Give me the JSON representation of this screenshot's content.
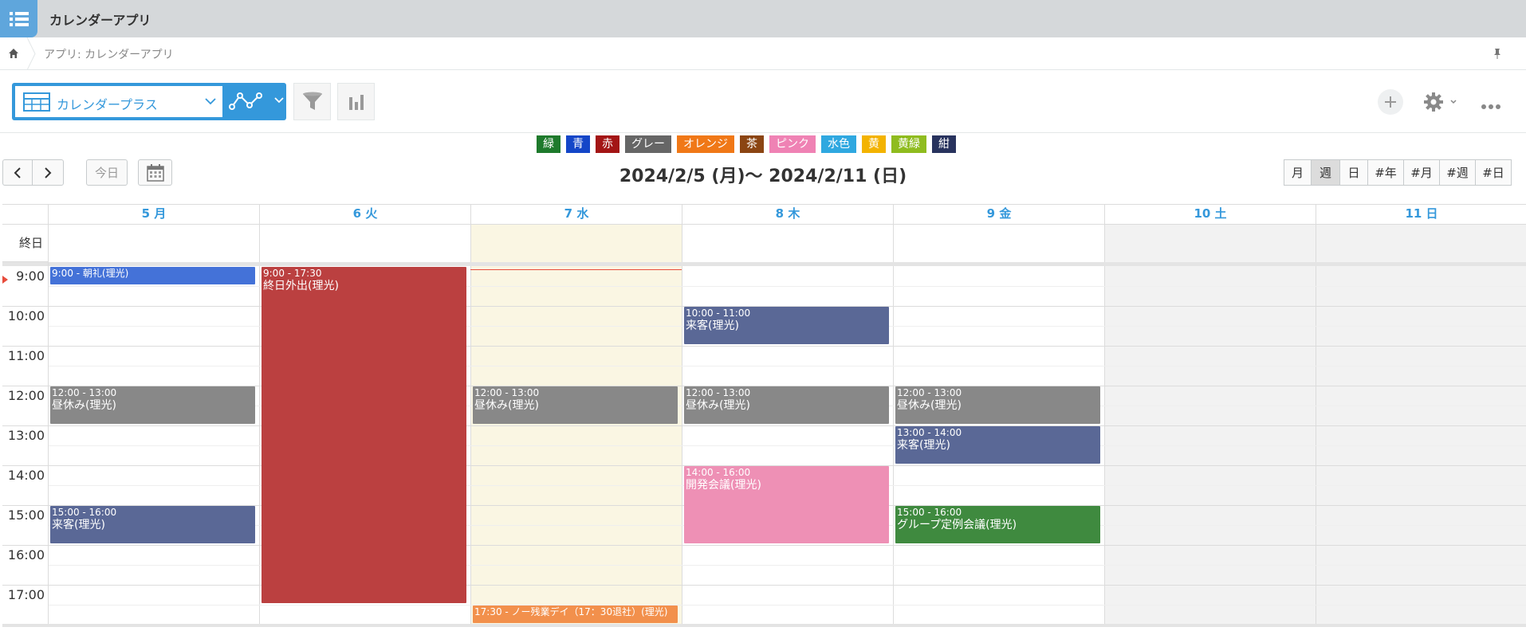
{
  "app": {
    "title": "カレンダーアプリ"
  },
  "breadcrumb": {
    "text": "アプリ: カレンダーアプリ"
  },
  "toolbar": {
    "view_label": "カレンダープラス"
  },
  "legend": [
    {
      "label": "緑",
      "color": "#1e7a2c"
    },
    {
      "label": "青",
      "color": "#1446c8"
    },
    {
      "label": "赤",
      "color": "#a31515"
    },
    {
      "label": "グレー",
      "color": "#666666"
    },
    {
      "label": "オレンジ",
      "color": "#f07817"
    },
    {
      "label": "茶",
      "color": "#8b4513"
    },
    {
      "label": "ピンク",
      "color": "#ef82b4"
    },
    {
      "label": "水色",
      "color": "#2fa8e0"
    },
    {
      "label": "黄",
      "color": "#f3b300"
    },
    {
      "label": "黄緑",
      "color": "#8fbc1f"
    },
    {
      "label": "紺",
      "color": "#28335e"
    }
  ],
  "nav": {
    "today_label": "今日",
    "range_title": "2024/2/5 (月)～ 2024/2/11 (日)"
  },
  "modes": [
    {
      "label": "月",
      "active": false
    },
    {
      "label": "週",
      "active": true
    },
    {
      "label": "日",
      "active": false
    },
    {
      "label": "#年",
      "active": false
    },
    {
      "label": "#月",
      "active": false
    },
    {
      "label": "#週",
      "active": false
    },
    {
      "label": "#日",
      "active": false
    }
  ],
  "calendar": {
    "allday_label": "終日",
    "days": [
      "5 月",
      "6 火",
      "7 水",
      "8 木",
      "9 金",
      "10 土",
      "11 日"
    ],
    "hours": [
      "9:00",
      "10:00",
      "11:00",
      "12:00",
      "13:00",
      "14:00",
      "15:00",
      "16:00",
      "17:00"
    ],
    "events": [
      {
        "day": 0,
        "start": 9,
        "end": 9.5,
        "time": "9:00 - 朝礼(理光)",
        "title": "",
        "color": "#4472d8"
      },
      {
        "day": 1,
        "start": 9,
        "end": 17.5,
        "time": "9:00 - 17:30",
        "title": "終日外出(理光)",
        "color": "#bb4040"
      },
      {
        "day": 3,
        "start": 10,
        "end": 11,
        "time": "10:00 - 11:00",
        "title": "来客(理光)",
        "color": "#5a6896"
      },
      {
        "day": 0,
        "start": 12,
        "end": 13,
        "time": "12:00 - 13:00",
        "title": "昼休み(理光)",
        "color": "#888888"
      },
      {
        "day": 2,
        "start": 12,
        "end": 13,
        "time": "12:00 - 13:00",
        "title": "昼休み(理光)",
        "color": "#888888"
      },
      {
        "day": 3,
        "start": 12,
        "end": 13,
        "time": "12:00 - 13:00",
        "title": "昼休み(理光)",
        "color": "#888888"
      },
      {
        "day": 4,
        "start": 12,
        "end": 13,
        "time": "12:00 - 13:00",
        "title": "昼休み(理光)",
        "color": "#888888"
      },
      {
        "day": 4,
        "start": 13,
        "end": 14,
        "time": "13:00 - 14:00",
        "title": "来客(理光)",
        "color": "#5a6896"
      },
      {
        "day": 3,
        "start": 14,
        "end": 16,
        "time": "14:00 - 16:00",
        "title": "開発会議(理光)",
        "color": "#ee90b5"
      },
      {
        "day": 0,
        "start": 15,
        "end": 16,
        "time": "15:00 - 16:00",
        "title": "来客(理光)",
        "color": "#5a6896"
      },
      {
        "day": 4,
        "start": 15,
        "end": 16,
        "time": "15:00 - 16:00",
        "title": "グループ定例会議(理光)",
        "color": "#3f8a3f"
      },
      {
        "day": 2,
        "start": 17.5,
        "end": 18,
        "time": "17:30 - ノー残業デイ（17：30退社）(理光)",
        "title": "",
        "color": "#f2904c"
      }
    ],
    "now_hour": 9.55,
    "today_index": 2
  }
}
